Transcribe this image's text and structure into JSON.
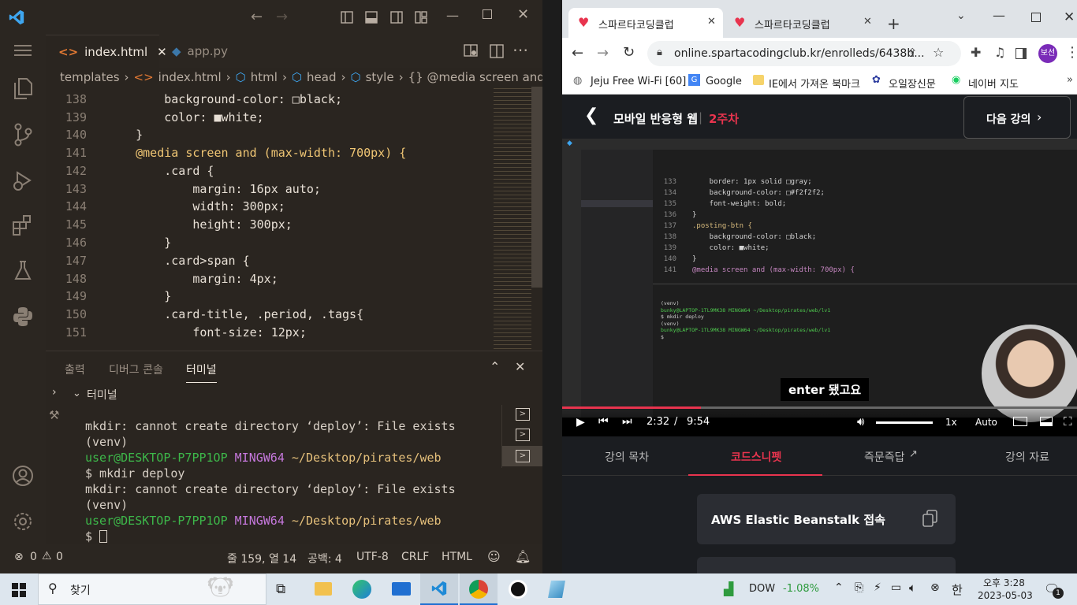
{
  "vscode": {
    "tabs": [
      {
        "label": "index.html"
      },
      {
        "label": "app.py"
      }
    ],
    "breadcrumb": [
      "templates",
      "index.html",
      "html",
      "head",
      "style",
      "{} @media screen and (ma"
    ],
    "code_lines": [
      {
        "n": "138",
        "t": "        background-color: □black;"
      },
      {
        "n": "139",
        "t": "        color: ■white;"
      },
      {
        "n": "140",
        "t": "    }"
      },
      {
        "n": "141",
        "t": "    @media screen and (max-width: 700px) {"
      },
      {
        "n": "142",
        "t": "        .card {"
      },
      {
        "n": "143",
        "t": "            margin: 16px auto;"
      },
      {
        "n": "144",
        "t": "            width: 300px;"
      },
      {
        "n": "145",
        "t": "            height: 300px;"
      },
      {
        "n": "146",
        "t": "        }"
      },
      {
        "n": "147",
        "t": "        .card>span {"
      },
      {
        "n": "148",
        "t": "            margin: 4px;"
      },
      {
        "n": "149",
        "t": "        }"
      },
      {
        "n": "150",
        "t": "        .card-title, .period, .tags{"
      },
      {
        "n": "151",
        "t": "            font-size: 12px;"
      }
    ],
    "panel_tabs": [
      "출력",
      "디버그 콘솔",
      "터미널"
    ],
    "terminal_header": "터미널",
    "terminal": {
      "l1": "mkdir: cannot create directory ‘deploy’: File exists",
      "l2": "(venv)",
      "l3_user": "user@DESKTOP-P7PP1OP",
      "l3_mingw": "MINGW64",
      "l3_path": "~/Desktop/pirates/web",
      "l4": "$ mkdir deploy",
      "l5": "mkdir: cannot create directory ‘deploy’: File exists",
      "l6": "(venv)",
      "l7_user": "user@DESKTOP-P7PP1OP",
      "l7_mingw": "MINGW64",
      "l7_path": "~/Desktop/pirates/web",
      "l8": "$"
    },
    "status": {
      "errors": "0",
      "warnings": "0",
      "position": "줄 159, 열 14",
      "spaces": "공백: 4",
      "encoding": "UTF-8",
      "eol": "CRLF",
      "language": "HTML"
    }
  },
  "browser": {
    "tabs": [
      {
        "label": "스파르타코딩클럽"
      },
      {
        "label": "스파르타코딩클럽"
      }
    ],
    "url": "online.spartacodingclub.kr/enrolleds/6438b...",
    "profile": "보선",
    "bookmarks": [
      "Jeju Free Wi-Fi [60]",
      "Google",
      "IE에서 가져온 북마크",
      "오일장신문",
      "네이버 지도"
    ],
    "course_title": "모바일 반응형 웹",
    "course_week": "2주차",
    "next_button": "다음 강의",
    "video": {
      "caption": "enter 됐고요",
      "time_current": "2:32",
      "time_sep": "/",
      "time_total": "9:54",
      "speed": "1x",
      "quality": "Auto",
      "progress": 0.27,
      "inner_code": [
        {
          "n": "133",
          "t": "    border: 1px solid □gray;"
        },
        {
          "n": "134",
          "t": "    background-color: □#f2f2f2;"
        },
        {
          "n": "135",
          "t": "    font-weight: bold;"
        },
        {
          "n": "136",
          "t": "}"
        },
        {
          "n": "137",
          "t": ".posting-btn {"
        },
        {
          "n": "138",
          "t": "    background-color: □black;"
        },
        {
          "n": "139",
          "t": "    color: ■white;"
        },
        {
          "n": "140",
          "t": "}"
        },
        {
          "n": "141",
          "t": "@media screen and (max-width: 700px) {"
        }
      ],
      "inner_terminal": [
        "(venv)",
        "bunky@LAPTOP-1TL9MK38 MINGW64 ~/Desktop/pirates/web/lv1",
        "$ mkdir deploy",
        "(venv)",
        "bunky@LAPTOP-1TL9MK38 MINGW64 ~/Desktop/pirates/web/lv1",
        "$"
      ]
    },
    "lecture_tabs": [
      "강의 목차",
      "코드스니펫",
      "즉문즉답",
      "강의 자료"
    ],
    "snippet_title": "AWS Elastic Beanstalk 접속"
  },
  "taskbar": {
    "search": "찾기",
    "stock_name": "DOW",
    "stock_change": "-1.08%",
    "ime": "한",
    "clock_time": "오후 3:28",
    "clock_date": "2023-05-03",
    "notif_count": "1"
  },
  "colors": {
    "accent_red": "#e8344e",
    "vs_bg": "#2a2520",
    "term_green": "#3db84a",
    "term_purple": "#c678dd",
    "term_yellow": "#e5c07b"
  }
}
